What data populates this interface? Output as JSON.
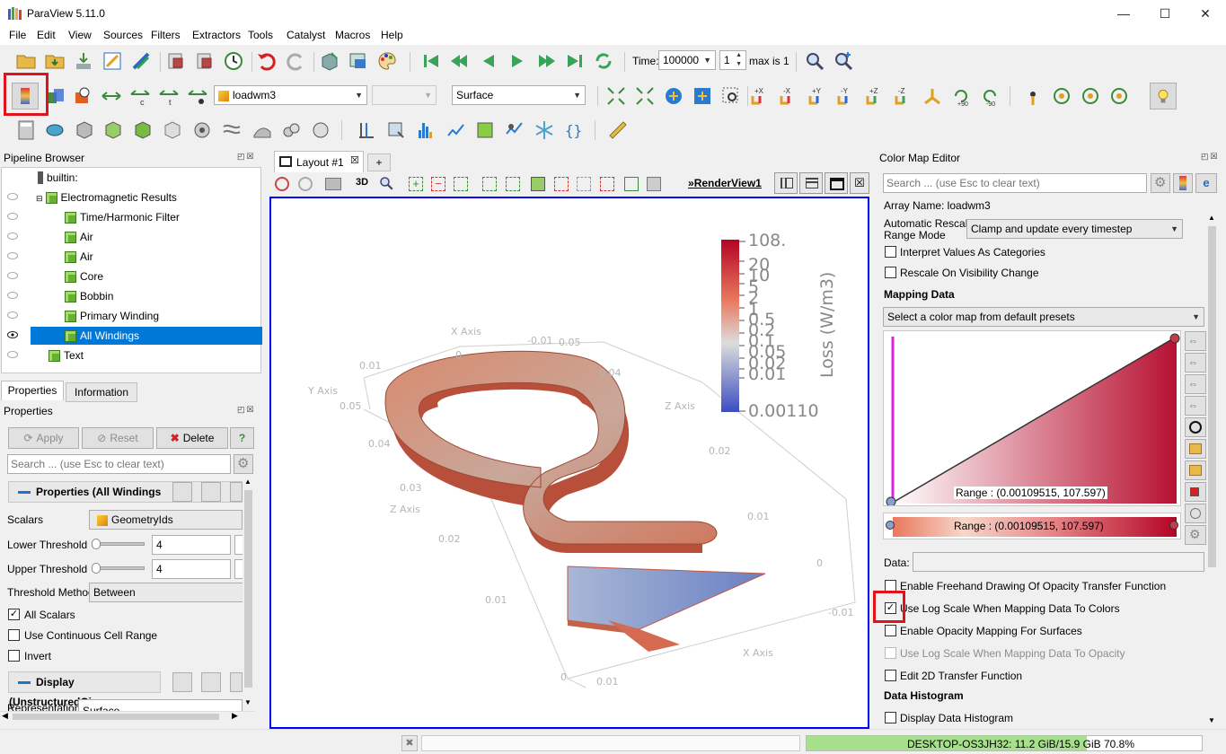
{
  "window": {
    "title": "ParaView 5.11.0",
    "minimize": "—",
    "maximize": "☐",
    "close": "✕"
  },
  "menu": [
    "File",
    "Edit",
    "View",
    "Sources",
    "Filters",
    "Extractors",
    "Tools",
    "Catalyst",
    "Macros",
    "Help"
  ],
  "time_toolbar": {
    "time_label": "Time:",
    "time_value": "100000",
    "index_value": "1",
    "max_text": "max is 1"
  },
  "toolbar2": {
    "array_combo": "loadwm3",
    "component_combo": "",
    "representation_combo": "Surface"
  },
  "pipeline_browser": {
    "title": "Pipeline Browser",
    "items": [
      {
        "label": "builtin:",
        "visible": null
      },
      {
        "label": "Electromagnetic Results",
        "visible": false
      },
      {
        "label": "Time/Harmonic Filter",
        "visible": false
      },
      {
        "label": "Air",
        "visible": false
      },
      {
        "label": "Air",
        "visible": false
      },
      {
        "label": "Core",
        "visible": false
      },
      {
        "label": "Bobbin",
        "visible": false
      },
      {
        "label": "Primary Winding",
        "visible": false
      },
      {
        "label": "All Windings",
        "visible": true
      },
      {
        "label": "Text",
        "visible": false
      }
    ]
  },
  "properties_panel": {
    "tabs": [
      "Properties",
      "Information"
    ],
    "header": "Properties",
    "apply": "Apply",
    "reset": "Reset",
    "delete": "Delete",
    "help": "?",
    "search_placeholder": "Search ... (use Esc to clear text)",
    "section_properties": "Properties (All Windings",
    "scalars_label": "Scalars",
    "scalars_value": "GeometryIds",
    "lower_label": "Lower Threshold",
    "lower_value": "4",
    "upper_label": "Upper Threshold",
    "upper_value": "4",
    "method_label": "Threshold Method",
    "method_value": "Between",
    "all_scalars": "All Scalars",
    "continuous": "Use Continuous Cell Range",
    "invert": "Invert",
    "section_display": "Display (UnstructuredGi",
    "representation_label": "Representation",
    "representation_value": "Surface"
  },
  "layout": {
    "tab_label": "Layout #1",
    "add_tab": "+",
    "view_3d": "3D",
    "render_view": "RenderView1",
    "axes": {
      "x_axis": "X Axis",
      "y_axis": "Y Axis",
      "z_axis_left": "Z Axis",
      "z_axis_right": "Z Axis",
      "x_axis_bottom": "X Axis",
      "ticks": [
        "-0.01",
        "0.05",
        "0",
        "0.04",
        "0.01",
        "0.05",
        "0.04",
        "0.03",
        "0.02",
        "0.01",
        "0",
        "0.02",
        "0.01",
        "0",
        "-0.01",
        "0.01"
      ]
    },
    "colorbar": {
      "title": "Loss (W/m3)",
      "max": "108.",
      "labels": [
        "20",
        "10",
        "5",
        "2",
        "1",
        "0.5",
        "0.2",
        "0.1",
        "0.05",
        "0.02",
        "0.01"
      ],
      "min": "0.00110"
    }
  },
  "color_map_editor": {
    "title": "Color Map Editor",
    "search_placeholder": "Search ... (use Esc to clear text)",
    "array_name": "Array Name: loadwm3",
    "auto_rescale_label_1": "Automatic Rescale",
    "auto_rescale_label_2": "Range Mode",
    "auto_rescale_value": "Clamp and update every timestep",
    "interpret_categories": "Interpret Values As Categories",
    "rescale_visibility": "Rescale On Visibility Change",
    "mapping_data": "Mapping Data",
    "preset_placeholder": "Select a color map from default presets",
    "range_text_1": "Range : (0.00109515, 107.597)",
    "range_text_2": "Range : (0.00109515, 107.597)",
    "data_label": "Data:",
    "freehand": "Enable Freehand Drawing Of Opacity Transfer Function",
    "log_scale_colors": "Use Log Scale When Mapping Data To Colors",
    "opacity_surfaces": "Enable Opacity Mapping For Surfaces",
    "log_scale_opacity": "Use Log Scale When Mapping Data To Opacity",
    "edit_2d": "Edit 2D Transfer Function",
    "data_histogram": "Data Histogram",
    "display_histogram": "Display Data Histogram"
  },
  "statusbar": {
    "memory": "DESKTOP-OS3JH32: 11.2 GiB/15.9 GiB 70.8%",
    "memory_fraction": 0.708
  },
  "colors": {
    "accent": "#0078d7",
    "highlight": "#e0131c",
    "view_border": "#0000ff",
    "memory_bar": "#a7e08c"
  }
}
